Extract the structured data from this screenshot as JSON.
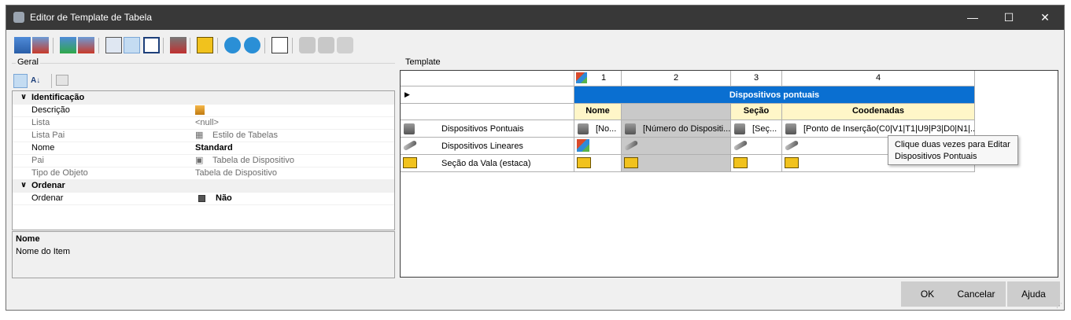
{
  "window": {
    "title": "Editor de Template de Tabela",
    "controls": {
      "minimize": "—",
      "maximize": "☐",
      "close": "✕"
    }
  },
  "left": {
    "group_label": "Geral",
    "categories": [
      {
        "label": "Identificação"
      },
      {
        "label": "Ordenar"
      }
    ],
    "rows": [
      {
        "key": "Descrição",
        "value": ""
      },
      {
        "key": "Lista",
        "value": "<null>"
      },
      {
        "key": "Lista Pai",
        "value": "Estilo de Tabelas"
      },
      {
        "key": "Nome",
        "value": "Standard"
      },
      {
        "key": "Pai",
        "value": "Tabela de Dispositivo"
      },
      {
        "key": "Tipo de Objeto",
        "value": "Tabela de Dispositivo"
      },
      {
        "key": "Ordenar",
        "value": "Não"
      }
    ],
    "description": {
      "title": "Nome",
      "text": "Nome do Item"
    }
  },
  "template": {
    "group_label": "Template",
    "columns": [
      "1",
      "2",
      "3",
      "4"
    ],
    "group_header": "Dispositivos pontuais",
    "subheaders": [
      "Nome",
      "",
      "Seção",
      "Coodenadas"
    ],
    "rows": [
      {
        "label": "Dispositivos Pontuais",
        "cells": [
          "[No...",
          "[Número do Dispositi...",
          "[Seç...",
          "[Ponto de Inserção(C0|V1|T1|U9|P3|D0|N1|..."
        ]
      },
      {
        "label": "Dispositivos Lineares",
        "cells": [
          "",
          "",
          "",
          ""
        ]
      },
      {
        "label": "Seção da Vala (estaca)",
        "cells": [
          "",
          "",
          "",
          ""
        ]
      }
    ],
    "tooltip": "Clique duas vezes para Editar Dispositivos Pontuais"
  },
  "buttons": {
    "ok": "OK",
    "cancel": "Cancelar",
    "help": "Ajuda"
  }
}
